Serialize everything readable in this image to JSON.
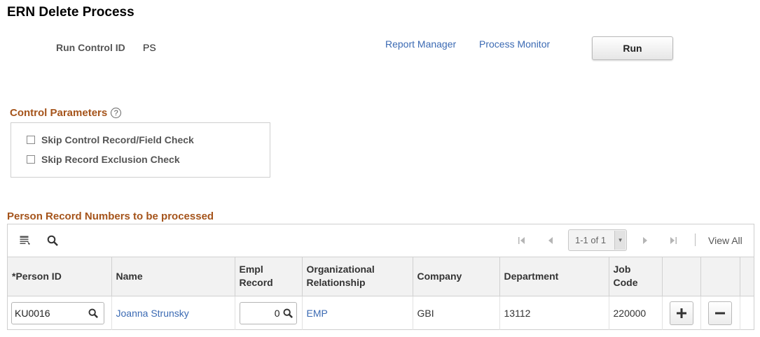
{
  "page": {
    "title": "ERN Delete Process",
    "run_control_label": "Run Control ID",
    "run_control_value": "PS",
    "report_manager": "Report Manager",
    "process_monitor": "Process Monitor",
    "run_label": "Run"
  },
  "control_parameters": {
    "title": "Control Parameters",
    "help": "?",
    "options": [
      {
        "label": "Skip Control Record/Field Check",
        "checked": false
      },
      {
        "label": "Skip Record Exclusion Check",
        "checked": false
      }
    ]
  },
  "grid": {
    "title": "Person Record Numbers to be processed",
    "pager_text": "1-1 of 1",
    "view_all": "View All",
    "headers": {
      "person_id": "*Person ID",
      "name": "Name",
      "empl_record_1": "Empl",
      "empl_record_2": "Record",
      "org_rel_1": "Organizational",
      "org_rel_2": "Relationship",
      "company": "Company",
      "department": "Department",
      "job_code_1": "Job",
      "job_code_2": "Code"
    },
    "rows": [
      {
        "person_id": "KU0016",
        "name": "Joanna Strunsky",
        "empl_record": "0",
        "org_relationship": "EMP",
        "company": "GBI",
        "department": "13112",
        "job_code": "220000"
      }
    ]
  },
  "colors": {
    "section_title": "#a5541b",
    "link": "#3b6ab3"
  },
  "icons": [
    "personalize-grid-icon",
    "search-icon",
    "first-page-icon",
    "previous-icon",
    "next-icon",
    "last-page-icon",
    "help-icon",
    "lookup-icon",
    "add-row-icon",
    "delete-row-icon"
  ]
}
